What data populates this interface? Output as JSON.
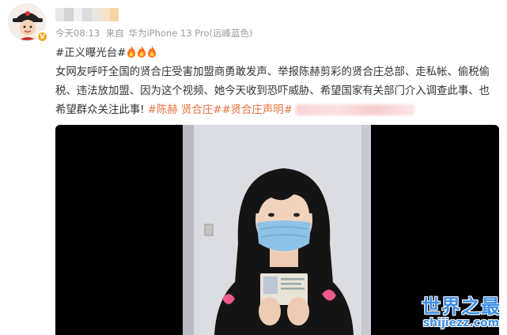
{
  "post": {
    "meta": {
      "time": "今天08:13",
      "visibility": "来自",
      "device": "华为iPhone 13 Pro(远峰蓝色)"
    },
    "hashtag": "#正义曝光台#",
    "body": "女网友呼吁全国的贤合庄受害加盟商勇敢发声、举报陈赫剪彩的贤合庄总部、走私帐、偷税偷税、违法放加盟、因为这个视频、她今天收到恐吓威胁、希望国家有关部门介入调查此事、也希望群众关注此事!",
    "tags": [
      "#陈赫 贤合庄#",
      "#贤合庄声明#"
    ]
  },
  "colors": {
    "tag": "#eb7340",
    "text": "#333333",
    "meta": "#9a9a9a",
    "watermark": "#3f8fe8"
  },
  "watermark": {
    "main": "世界之最",
    "sub": "shijiezz.com"
  }
}
